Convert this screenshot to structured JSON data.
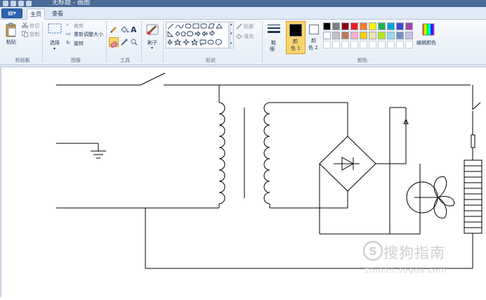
{
  "window": {
    "title": "无标题 - 画图"
  },
  "tabs": {
    "file_label": "▤▾",
    "home": "主页",
    "view": "查看"
  },
  "clipboard": {
    "paste": "粘贴",
    "cut": "剪切",
    "copy": "复制",
    "group": "剪贴板"
  },
  "image": {
    "select": "选择",
    "crop": "裁剪",
    "resize": "重新调整大小",
    "rotate": "旋转",
    "group": "图像"
  },
  "tools": {
    "group": "工具"
  },
  "brushes": {
    "label": "刷子"
  },
  "shapes": {
    "outline": "轮廓",
    "fill": "填充",
    "group": "形状"
  },
  "size": {
    "line1": "粗",
    "line2": "细"
  },
  "colors": {
    "color1_line1": "颜",
    "color1_line2": "色 1",
    "color2_line1": "颜",
    "color2_line2": "色 2",
    "edit": "编辑颜色",
    "group": "颜色",
    "color1": "#000000",
    "color2": "#ffffff",
    "row1": [
      "#000000",
      "#7f7f7f",
      "#880015",
      "#ed1c24",
      "#ff7f27",
      "#fff200",
      "#22b14c",
      "#00a2e8",
      "#3f48cc",
      "#a349a4"
    ],
    "row2": [
      "#ffffff",
      "#c3c3c3",
      "#b97a57",
      "#ffaec9",
      "#ffc90e",
      "#efe4b0",
      "#b5e61d",
      "#99d9ea",
      "#7092be",
      "#c8bfe7"
    ]
  },
  "watermark": {
    "brand": "搜狗指南",
    "url": "zhinan.sogou.com"
  }
}
